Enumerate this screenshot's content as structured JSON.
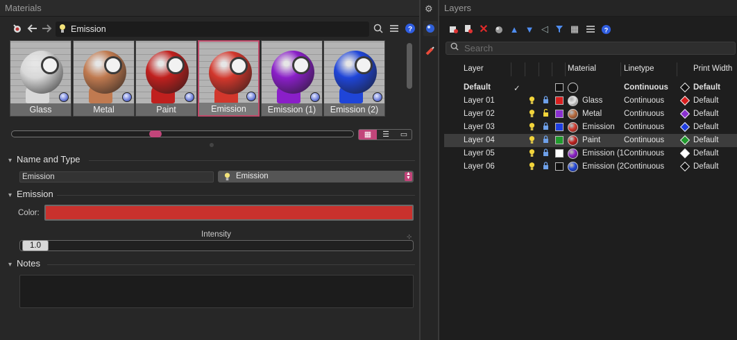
{
  "materials": {
    "title": "Materials",
    "path_name": "Emission",
    "thumbnails": [
      {
        "label": "Glass",
        "ball": "#d8d8d8",
        "selected": false
      },
      {
        "label": "Metal",
        "ball": "#c07a50",
        "selected": false
      },
      {
        "label": "Paint",
        "ball": "#c0201e",
        "selected": false
      },
      {
        "label": "Emission",
        "ball": "#d2372c",
        "selected": true
      },
      {
        "label": "Emission (1)",
        "ball": "#8a1fc8",
        "selected": false
      },
      {
        "label": "Emission (2)",
        "ball": "#1f45d8",
        "selected": false
      }
    ],
    "sections": {
      "name_type": "Name and Type",
      "emission": "Emission",
      "notes": "Notes"
    },
    "name_value": "Emission",
    "type_value": "Emission",
    "color_label": "Color:",
    "color_value": "#c9312d",
    "intensity_label": "Intensity",
    "intensity_value": "1.0"
  },
  "layers": {
    "title": "Layers",
    "search_placeholder": "Search",
    "columns": {
      "layer": "Layer",
      "material": "Material",
      "linetype": "Linetype",
      "print_width": "Print Width"
    },
    "default_row": {
      "name": "Default",
      "linetype": "Continuous",
      "print_width": "Default"
    },
    "rows": [
      {
        "name": "Layer 01",
        "color": "#d81e1e",
        "material": "Glass",
        "ball": "#e6e6e6",
        "linetype": "Continuous",
        "print_width": "Default",
        "pw_color": "#d81e1e",
        "locked": true
      },
      {
        "name": "Layer 02",
        "color": "#8a2fd0",
        "material": "Metal",
        "ball": "#b86a3c",
        "linetype": "Continuous",
        "print_width": "Default",
        "pw_color": "#8a2fd0",
        "locked": false
      },
      {
        "name": "Layer 03",
        "color": "#1e3ee0",
        "material": "Emission",
        "ball": "#d2372c",
        "linetype": "Continuous",
        "print_width": "Default",
        "pw_color": "#1e3ee0",
        "locked": true
      },
      {
        "name": "Layer 04",
        "color": "#1f9a2c",
        "material": "Paint",
        "ball": "#c0201e",
        "linetype": "Continuous",
        "print_width": "Default",
        "pw_color": "#1f9a2c",
        "locked": true
      },
      {
        "name": "Layer 05",
        "color": "#ffffff",
        "material": "Emission (1",
        "ball": "#8a1fc8",
        "linetype": "Continuous",
        "print_width": "Default",
        "pw_color": "#ffffff",
        "locked": true
      },
      {
        "name": "Layer 06",
        "color": "#111111",
        "material": "Emission (2",
        "ball": "#1f45d8",
        "linetype": "Continuous",
        "print_width": "Default",
        "pw_color": "#111111",
        "locked": true
      }
    ]
  }
}
